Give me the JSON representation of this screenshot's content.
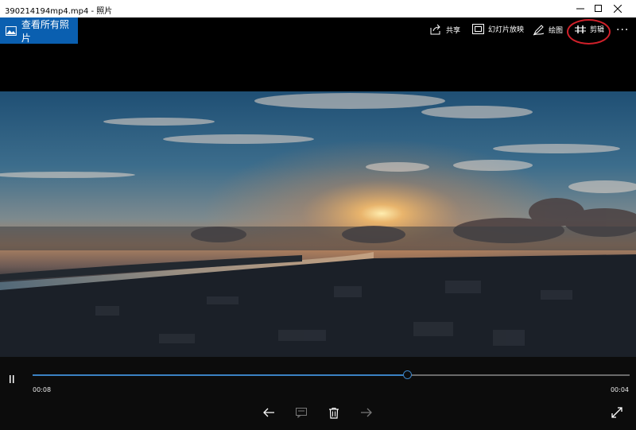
{
  "window": {
    "title": "390214194mp4.mp4 - 照片"
  },
  "toolbar": {
    "back_label": "查看所有照片",
    "share_label": "共享",
    "slideshow_label": "幻灯片放映",
    "draw_label": "绘图",
    "edit_label": "剪辑",
    "more_label": "···"
  },
  "player": {
    "current_time": "00:08",
    "total_time": "00:04",
    "progress": 0.629
  },
  "colors": {
    "accent": "#0a5fb0",
    "progress": "#3b82c4",
    "annotation": "#d0202a"
  }
}
